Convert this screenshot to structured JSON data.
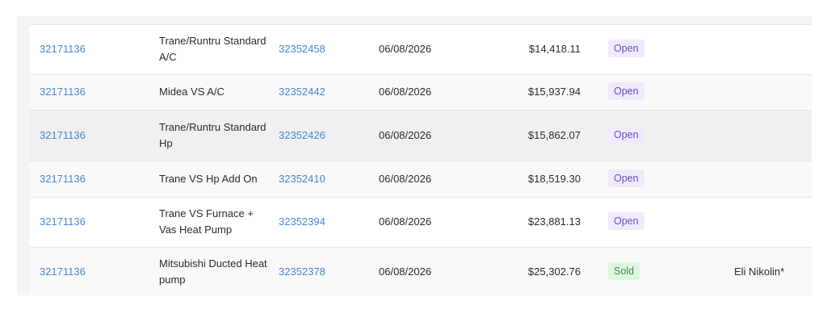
{
  "rows": [
    {
      "record_id": "32171136",
      "description": "Trane/Runtru Standard A/C",
      "number": "32352458",
      "date": "06/08/2026",
      "amount": "$14,418.11",
      "status": "Open",
      "rep": ""
    },
    {
      "record_id": "32171136",
      "description": "Midea VS A/C",
      "number": "32352442",
      "date": "06/08/2026",
      "amount": "$15,937.94",
      "status": "Open",
      "rep": ""
    },
    {
      "record_id": "32171136",
      "description": "Trane/Runtru Standard Hp",
      "number": "32352426",
      "date": "06/08/2026",
      "amount": "$15,862.07",
      "status": "Open",
      "rep": ""
    },
    {
      "record_id": "32171136",
      "description": "Trane VS Hp Add On",
      "number": "32352410",
      "date": "06/08/2026",
      "amount": "$18,519.30",
      "status": "Open",
      "rep": ""
    },
    {
      "record_id": "32171136",
      "description": "Trane VS Furnace + Vas Heat Pump",
      "number": "32352394",
      "date": "06/08/2026",
      "amount": "$23,881.13",
      "status": "Open",
      "rep": ""
    },
    {
      "record_id": "32171136",
      "description": "Mitsubishi Ducted Heat pump",
      "number": "32352378",
      "date": "06/08/2026",
      "amount": "$25,302.76",
      "status": "Sold",
      "rep": "Eli Nikolin*"
    }
  ],
  "colors": {
    "link": "#4a86d4",
    "open_badge_bg": "#efeafc",
    "open_badge_text": "#6b4fbf",
    "sold_badge_bg": "#dff5e1",
    "sold_badge_text": "#3a8a48"
  }
}
